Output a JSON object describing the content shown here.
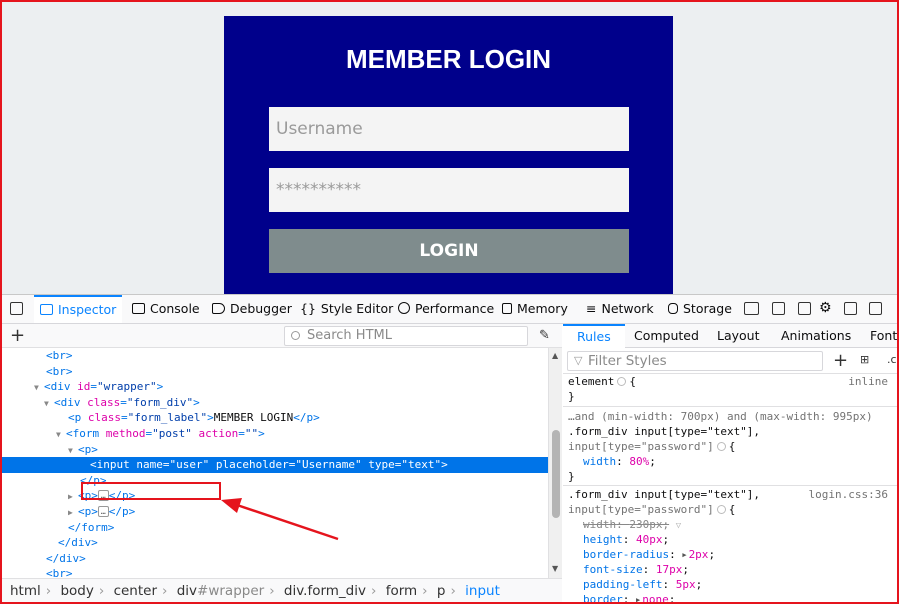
{
  "page": {
    "login_title": "MEMBER LOGIN",
    "username_placeholder": "Username",
    "password_placeholder": "**********",
    "login_button": "LOGIN",
    "colors": {
      "box": "#00008b",
      "button": "#7f8c8d",
      "field": "#f4f4f4"
    }
  },
  "devtools": {
    "tabs": [
      {
        "label": "Inspector",
        "icon": "inspector-icon"
      },
      {
        "label": "Console",
        "icon": "console-icon"
      },
      {
        "label": "Debugger",
        "icon": "debugger-icon"
      },
      {
        "label": "Style Editor",
        "icon": "style-editor-icon"
      },
      {
        "label": "Performance",
        "icon": "performance-icon"
      },
      {
        "label": "Memory",
        "icon": "memory-icon"
      },
      {
        "label": "Network",
        "icon": "network-icon"
      },
      {
        "label": "Storage",
        "icon": "storage-icon"
      }
    ],
    "search_html_placeholder": "Search HTML",
    "tree": [
      {
        "tag": "br"
      },
      {
        "tag": "br"
      },
      {
        "open": "div",
        "attrs": [
          [
            "id",
            "wrapper"
          ]
        ]
      },
      {
        "open": "div",
        "attrs": [
          [
            "class",
            "form_div"
          ]
        ]
      },
      {
        "open": "p",
        "attrs": [
          [
            "class",
            "form_label"
          ]
        ],
        "text": "MEMBER LOGIN",
        "close": "p"
      },
      {
        "open": "form",
        "attrs": [
          [
            "method",
            "post"
          ],
          [
            "action",
            ""
          ]
        ]
      },
      {
        "open": "p"
      },
      {
        "open": "input",
        "attrs": [
          [
            "name",
            "user"
          ],
          [
            "placeholder",
            "Username"
          ],
          [
            "type",
            "text"
          ]
        ]
      },
      {
        "closeonly": "p"
      },
      {
        "collapsed": "p"
      },
      {
        "collapsed": "p"
      },
      {
        "closeonly": "form"
      },
      {
        "closeonly": "div"
      },
      {
        "closeonly": "div"
      },
      {
        "tag": "br"
      }
    ],
    "breadcrumbs": {
      "html": "html",
      "body": "body",
      "center": "center",
      "div_tag": "div",
      "div_id": "#wrapper",
      "div2_tag": "div",
      "div2_class": ".form_div",
      "form": "form",
      "p": "p",
      "input": "input"
    },
    "rules_tabs": [
      "Rules",
      "Computed",
      "Layout",
      "Animations",
      "Fonts"
    ],
    "filter_placeholder": "Filter Styles",
    "rules": {
      "element_selector": "element",
      "element_src": "inline",
      "media_query": "…and (min-width: 700px) and (max-width: 995px)",
      "sel1_a": ".form_div input[type=\"text\"],",
      "sel1_b": "input[type=\"password\"]",
      "r1_prop": "width",
      "r1_val": "80%",
      "sel2_a": ".form_div input[type=\"text\"],",
      "sel2_src": "login.css:36",
      "sel2_b": "input[type=\"password\"]",
      "decls": [
        {
          "prop": "width",
          "val": "230px",
          "struck": true
        },
        {
          "prop": "height",
          "val": "40px"
        },
        {
          "prop": "border-radius",
          "val": "2px"
        },
        {
          "prop": "font-size",
          "val": "17px"
        },
        {
          "prop": "padding-left",
          "val": "5px"
        },
        {
          "prop": "border",
          "val": "none"
        }
      ]
    }
  }
}
